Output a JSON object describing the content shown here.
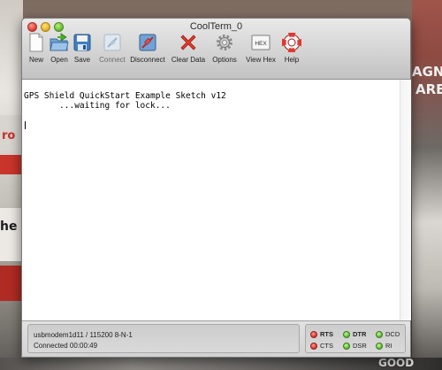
{
  "window": {
    "title": "CoolTerm_0"
  },
  "toolbar": {
    "items": [
      {
        "label": "New",
        "icon": "new-document-icon"
      },
      {
        "label": "Open",
        "icon": "open-folder-icon"
      },
      {
        "label": "Save",
        "icon": "save-floppy-icon"
      },
      {
        "label": "Connect",
        "icon": "connect-plug-icon",
        "enabled": false
      },
      {
        "label": "Disconnect",
        "icon": "disconnect-icon"
      },
      {
        "label": "Clear Data",
        "icon": "clear-x-icon"
      },
      {
        "label": "Options",
        "icon": "gear-icon"
      },
      {
        "label": "View Hex",
        "icon": "hex-view-icon",
        "icon_text": "HEX"
      },
      {
        "label": "Help",
        "icon": "lifebuoy-help-icon"
      }
    ]
  },
  "terminal": {
    "lines": [
      "GPS Shield QuickStart Example Sketch v12",
      "       ...waiting for lock..."
    ]
  },
  "status": {
    "port": "usbmodem1d11 / 115200 8-N-1",
    "connection": "Connected 00:00:49"
  },
  "signals": [
    {
      "label": "RTS",
      "color": "#e2382e",
      "bold": true
    },
    {
      "label": "DTR",
      "color": "#5ec42f",
      "bold": true
    },
    {
      "label": "DCD",
      "color": "#5ec42f",
      "bold": false
    },
    {
      "label": "CTS",
      "color": "#e2382e",
      "bold": false
    },
    {
      "label": "DSR",
      "color": "#5ec42f",
      "bold": false
    },
    {
      "label": "RI",
      "color": "#5ec42f",
      "bold": false
    }
  ],
  "background": {
    "left_text": "ro",
    "left_text2": "he",
    "right_text": "AGNE",
    "right_text2": "ARE",
    "bottom_text": "GOOD"
  }
}
